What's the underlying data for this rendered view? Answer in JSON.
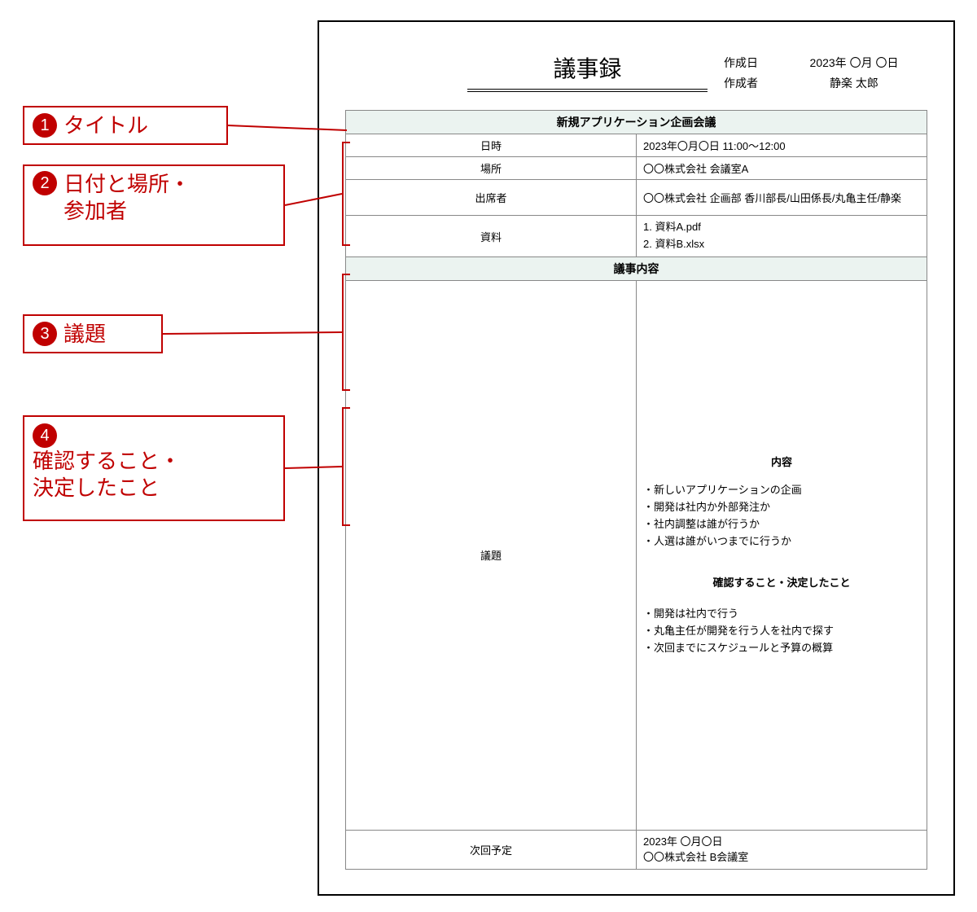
{
  "doc": {
    "title": "議事録",
    "created_label": "作成日",
    "created_value": "2023年 〇月 〇日",
    "author_label": "作成者",
    "author_value": "静楽 太郎",
    "meeting_title": "新規アプリケーション企画会議",
    "rows": {
      "datetime_label": "日時",
      "datetime_value": "2023年〇月〇日 11:00～12:00",
      "place_label": "場所",
      "place_value": "〇〇株式会社 会議室A",
      "attendees_label": "出席者",
      "attendees_value": "〇〇株式会社 企画部 香川部長/山田係長/丸亀主任/静楽",
      "docs_label": "資料",
      "docs_value1": "1. 資料A.pdf",
      "docs_value2": "2. 資料B.xlsx"
    },
    "content_header": "議事内容",
    "gidai_label": "議題",
    "naiyou_label": "内容",
    "bullets": {
      "b1": "・新しいアプリケーションの企画",
      "b2": "・開発は社内か外部発注か",
      "b3": "・社内調整は誰が行うか",
      "b4": "・人選は誰がいつまでに行うか"
    },
    "confirm_header": "確認すること・決定したこと",
    "confirm": {
      "c1": "・開発は社内で行う",
      "c2": "・丸亀主任が開発を行う人を社内で探す",
      "c3": "・次回までにスケジュールと予算の概算"
    },
    "next_label": "次回予定",
    "next_value1": "2023年 〇月〇日",
    "next_value2": "〇〇株式会社 B会議室"
  },
  "anno": {
    "a1": "タイトル",
    "a2_l1": "日付と場所・",
    "a2_l2": "参加者",
    "a3": "議題",
    "a4_l1": "確認すること・",
    "a4_l2": "決定したこと",
    "n1": "1",
    "n2": "2",
    "n3": "3",
    "n4": "4"
  }
}
